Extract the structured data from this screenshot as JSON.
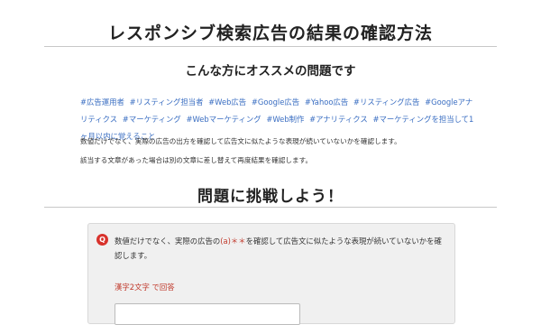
{
  "page": {
    "title": "レスポンシブ検索広告の結果の確認方法",
    "subheading": "こんな方にオススメの問題です"
  },
  "tags": [
    "#広告運用者",
    "#リスティング担当者",
    "#Web広告",
    "#Google広告",
    "#Yahoo広告",
    "#リスティング広告",
    "#Googleアナリティクス",
    "#マーケティング",
    "#Webマーケティング",
    "#Web制作",
    "#アナリティクス",
    "#マーケティングを担当して1ヶ月以内に覚えること"
  ],
  "description": {
    "line1": "数値だけでなく、実際の広告の出方を確認して広告文に似たような表現が続いていないかを確認します。",
    "line2": "該当する文章があった場合は別の文章に差し替えて再度結果を確認します。"
  },
  "challenge": {
    "heading": "問題に挑戦しよう！",
    "badge": "Q",
    "question_before": "数値だけでなく、実際の広告の",
    "question_blank": "(a)＊＊",
    "question_after": "を確認して広告文に似たような表現が続いていないかを確認します。",
    "hint": "漢字2文字 で回答",
    "answer_value": ""
  },
  "colors": {
    "tag_link": "#3a6ec2",
    "accent_red": "#d8322c",
    "card_bg": "#f0f0f0"
  }
}
